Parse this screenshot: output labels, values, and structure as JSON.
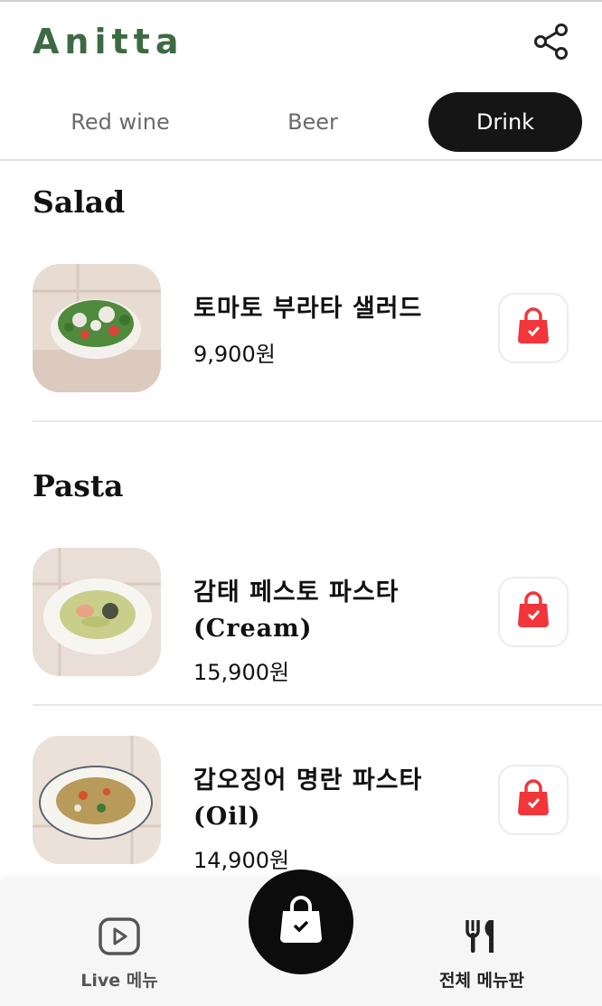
{
  "header": {
    "logo": "Anitta",
    "share_icon": "share-icon"
  },
  "tabs": [
    {
      "label": "Red wine",
      "active": false
    },
    {
      "label": "Beer",
      "active": false
    },
    {
      "label": "Drink",
      "active": true
    }
  ],
  "sections": [
    {
      "title": "Salad",
      "items": [
        {
          "name_line1": "토마토 부라타 샐러드",
          "name_line2": "",
          "price": "9,900원",
          "image": "salad-photo"
        }
      ]
    },
    {
      "title": "Pasta",
      "items": [
        {
          "name_line1": "감태 페스토 파스타",
          "name_line2": "(Cream)",
          "price": "15,900원",
          "image": "pesto-pasta-photo"
        },
        {
          "name_line1": "갑오징어 명란 파스타",
          "name_line2": "(Oil)",
          "price": "14,900원",
          "image": "squid-pasta-photo"
        }
      ]
    }
  ],
  "bottom_nav": {
    "live_menu_label": "Live 메뉴",
    "full_menu_label": "전체 메뉴판"
  },
  "colors": {
    "brand": "#3e6a43",
    "cart_red": "#f2353b",
    "active_tab": "#151515"
  }
}
